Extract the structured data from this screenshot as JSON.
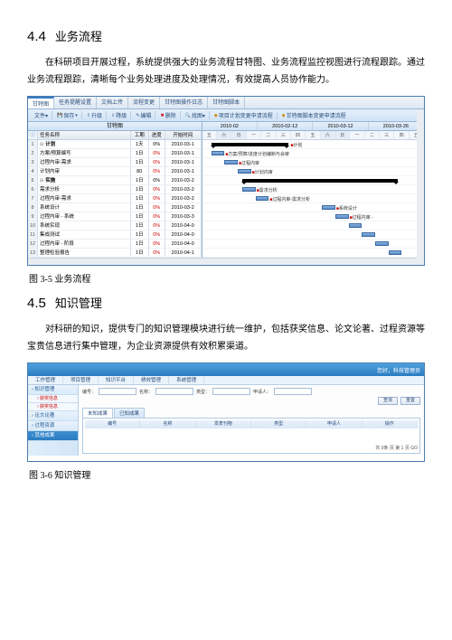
{
  "s44": {
    "num": "4.4",
    "title": "业务流程",
    "body": "在科研项目开展过程，系统提供强大的业务流程甘特图、业务流程监控视图进行流程跟踪。通过业务流程跟踪，清晰每个业务处理进度及处理情况，有效提高人员协作能力。",
    "caption": "图 3-5  业务流程"
  },
  "gantt": {
    "tabs": [
      "甘特图",
      "任务提醒设置",
      "文档上传",
      "流程变更",
      "甘特图操作日志",
      "甘特图脚本"
    ],
    "toolbar": {
      "file": "文件▾",
      "save": "保存",
      "up": "升级",
      "down": "降级",
      "edit": "编辑",
      "del": "删除",
      "find": "找图▾",
      "plan": "项目计划变更申请流程",
      "script": "甘特图脚本变更申请流程"
    },
    "panel_title": "甘特图",
    "cols": {
      "name": "任务名称",
      "dur": "工期",
      "prog": "进度",
      "start": "开始时间"
    },
    "dates": [
      "2010-02",
      "2010-02-12",
      "2010-03-12",
      "2010-03-26"
    ],
    "days": [
      "五",
      "六",
      "日",
      "一",
      "二",
      "三",
      "四",
      "五",
      "六",
      "日",
      "一",
      "二",
      "三",
      "四",
      "五"
    ],
    "rows": [
      {
        "n": "1",
        "name": "计划",
        "dur": "1天",
        "prog": "0%",
        "start": "2010-03-1",
        "expand": "⊟",
        "sum": true,
        "label": "计划",
        "left": "4%",
        "w": "35%"
      },
      {
        "n": "2",
        "name": "方案/预算编写",
        "dur": "1日",
        "prog": "0%",
        "start": "2010-03-1",
        "left": "4%",
        "w": "6%",
        "label": "方案/预算/进度计划编制与会审"
      },
      {
        "n": "3",
        "name": "过程内审-需求",
        "dur": "1日",
        "prog": "0%",
        "start": "2010-03-1",
        "left": "10%",
        "w": "6%",
        "label": "过程内审",
        "red": true
      },
      {
        "n": "4",
        "name": "计划内审",
        "dur": "80",
        "prog": "0%",
        "start": "2010-03-1",
        "left": "16%",
        "w": "6%",
        "label": "计划内审",
        "red": true
      },
      {
        "n": "5",
        "name": "实施",
        "dur": "1日",
        "prog": "0%",
        "start": "2010-03-2",
        "expand": "⊟",
        "sum": true,
        "left": "18%",
        "w": "70%",
        "label": ""
      },
      {
        "n": "6",
        "name": "需求分析",
        "dur": "1日",
        "prog": "0%",
        "start": "2010-03-2",
        "left": "18%",
        "w": "6%",
        "label": "需求分析"
      },
      {
        "n": "7",
        "name": "过程内审-需求",
        "dur": "1日",
        "prog": "0%",
        "start": "2010-03-2",
        "left": "24%",
        "w": "6%",
        "label": "过程内审-需求分析",
        "red": true
      },
      {
        "n": "8",
        "name": "系统设计",
        "dur": "1日",
        "prog": "0%",
        "start": "2010-03-2",
        "left": "54%",
        "w": "6%",
        "label": "系统设计"
      },
      {
        "n": "9",
        "name": "过程内审 - 系统",
        "dur": "1日",
        "prog": "0%",
        "start": "2010-03-3",
        "left": "60%",
        "w": "6%",
        "label": "过程内审 -",
        "red": true
      },
      {
        "n": "10",
        "name": "系统实现",
        "dur": "1日",
        "prog": "0%",
        "start": "2010-04-0",
        "left": "66%",
        "w": "6%",
        "label": ""
      },
      {
        "n": "11",
        "name": "集成测试",
        "dur": "1日",
        "prog": "0%",
        "start": "2010-04-0",
        "left": "72%",
        "w": "6%",
        "label": ""
      },
      {
        "n": "12",
        "name": "过程内审 - 阶段",
        "dur": "1日",
        "prog": "0%",
        "start": "2010-04-0",
        "left": "78%",
        "w": "6%",
        "label": "",
        "red": true
      },
      {
        "n": "13",
        "name": "整理检验报告",
        "dur": "1日",
        "prog": "0%",
        "start": "2010-04-1",
        "left": "84%",
        "w": "6%",
        "label": ""
      }
    ]
  },
  "s45": {
    "num": "4.5",
    "title": "知识管理",
    "body": "对科研的知识，提供专门的知识管理模块进行统一维护，包括获奖信息、论文论著、过程资源等宝贵信息进行集中管理，为企业资源提供有效积累渠道。",
    "caption": "图 3-6  知识管理"
  },
  "km": {
    "logo": "",
    "user": "您好，科技管理员",
    "menus": [
      "工作管理",
      "项目管理",
      "知识平台",
      "绩效管理",
      "系统管理"
    ],
    "side": [
      {
        "t": "知识管理",
        "lv": 1
      },
      {
        "t": "获奖信息",
        "lv": 2
      },
      {
        "t": "获奖信息",
        "lv": 2
      },
      {
        "t": "论文论著",
        "lv": 1
      },
      {
        "t": "过程资源",
        "lv": 1
      },
      {
        "t": "其他成果",
        "lv": 1,
        "sel": true
      }
    ],
    "form": {
      "f1": "编号：",
      "f2": "名称：",
      "f3": "类型：",
      "f4": "申请人：",
      "search": "查询",
      "reset": "重置"
    },
    "tabs2": [
      "未知成果",
      "已知成果"
    ],
    "cols": [
      "编号",
      "名称",
      "发表刊物",
      "类型",
      "申请人",
      "操作"
    ],
    "pager": "共 0条  页  第 1  页 GO"
  }
}
